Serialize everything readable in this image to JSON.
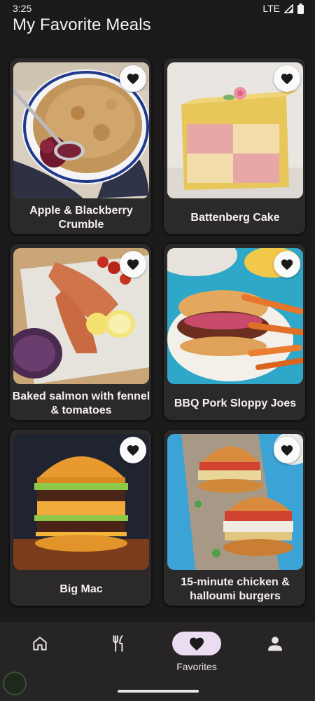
{
  "status": {
    "time": "3:25",
    "network": "LTE"
  },
  "header": {
    "title": "My Favorite Meals"
  },
  "meals": [
    {
      "name": "Apple & Blackberry Crumble",
      "favorite": true,
      "icon": "heart-icon"
    },
    {
      "name": "Battenberg Cake",
      "favorite": true,
      "icon": "heart-icon"
    },
    {
      "name": "Baked salmon with fennel & tomatoes",
      "favorite": true,
      "icon": "heart-icon"
    },
    {
      "name": "BBQ Pork Sloppy Joes",
      "favorite": true,
      "icon": "heart-icon"
    },
    {
      "name": "Big Mac",
      "favorite": true,
      "icon": "heart-icon"
    },
    {
      "name": "15-minute chicken & halloumi burgers",
      "favorite": true,
      "icon": "heart-icon"
    }
  ],
  "nav": {
    "items": [
      {
        "icon": "home-icon",
        "label": "",
        "active": false
      },
      {
        "icon": "restaurant-icon",
        "label": "",
        "active": false
      },
      {
        "icon": "heart-icon",
        "label": "Favorites",
        "active": true
      },
      {
        "icon": "person-icon",
        "label": "",
        "active": false
      }
    ]
  },
  "colors": {
    "background": "#1c1b1b",
    "card": "#2b2929",
    "active_pill": "#ebdcf2",
    "text": "#f4f0f0"
  }
}
